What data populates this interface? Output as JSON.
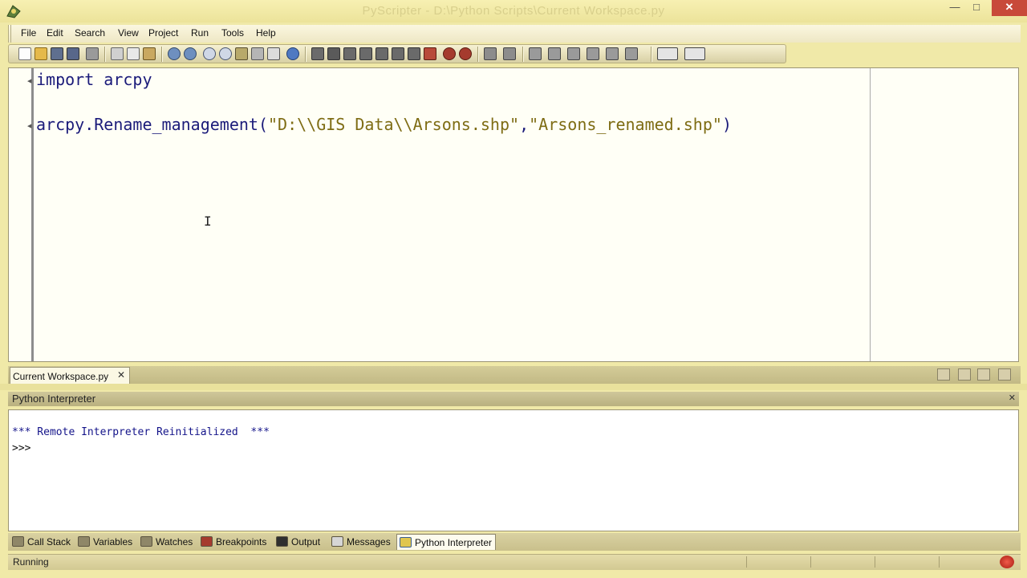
{
  "window": {
    "title": "PyScripter - D:\\Python Scripts\\Current Workspace.py",
    "minimize_icon": "minimize-icon",
    "maximize_icon": "maximize-icon",
    "close_label": "✕"
  },
  "menu": {
    "items": [
      "File",
      "Edit",
      "Search",
      "View",
      "Project",
      "Run",
      "Tools",
      "Help"
    ]
  },
  "toolbar": {
    "buttons": [
      "new-file",
      "open-file",
      "save",
      "save-all",
      "print",
      "cut",
      "copy",
      "paste",
      "undo",
      "redo",
      "find",
      "find-next",
      "replace",
      "find-in-files",
      "zoom",
      "help",
      "run",
      "debug",
      "run-to-cursor",
      "step-into",
      "step-over",
      "step-out",
      "pause",
      "abort",
      "toggle-breakpoint",
      "clear-breakpoints",
      "back",
      "forward",
      "indent",
      "dedent",
      "comment",
      "uncomment",
      "tabify",
      "untabify",
      "layouts",
      "view-options"
    ]
  },
  "editor": {
    "lines": [
      {
        "parts": [
          {
            "text": "import arcpy",
            "kind": "code"
          }
        ]
      },
      {
        "parts": [
          {
            "text": "arcpy.Rename_management(",
            "kind": "code"
          },
          {
            "text": "\"D:\\\\GIS Data\\\\Arsons.shp\"",
            "kind": "str"
          },
          {
            "text": ",",
            "kind": "code"
          },
          {
            "text": "\"Arsons_renamed.shp\"",
            "kind": "str"
          },
          {
            "text": ")",
            "kind": "code"
          }
        ]
      }
    ],
    "cursor_glyph": "I"
  },
  "document_tabs": [
    {
      "label": "Current Workspace.py",
      "close": "✕"
    }
  ],
  "panel": {
    "title": "Python Interpreter",
    "pin": "✕"
  },
  "console": {
    "lines": [
      "*** Remote Interpreter Reinitialized  ***",
      ">>>"
    ]
  },
  "tool_tabs": [
    {
      "label": "Call Stack",
      "icon": "call-stack-icon"
    },
    {
      "label": "Variables",
      "icon": "variables-icon"
    },
    {
      "label": "Watches",
      "icon": "watches-icon"
    },
    {
      "label": "Breakpoints",
      "icon": "breakpoints-icon"
    },
    {
      "label": "Output",
      "icon": "output-icon"
    },
    {
      "label": "Messages",
      "icon": "messages-icon"
    },
    {
      "label": "Python Interpreter",
      "icon": "python-icon",
      "active": true
    }
  ],
  "status": {
    "text": "Running"
  },
  "colors": {
    "code": "#1b1b7a",
    "string": "#7e6c14",
    "console_text": "#14148a"
  }
}
